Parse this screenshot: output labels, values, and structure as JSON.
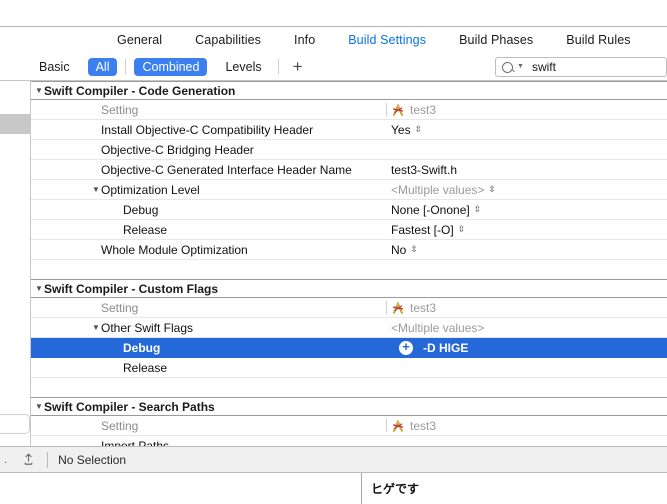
{
  "editor": {
    "tabs": [
      {
        "label": "General",
        "active": false
      },
      {
        "label": "Capabilities",
        "active": false
      },
      {
        "label": "Info",
        "active": false
      },
      {
        "label": "Build Settings",
        "active": true
      },
      {
        "label": "Build Phases",
        "active": false
      },
      {
        "label": "Build Rules",
        "active": false
      }
    ]
  },
  "filterbar": {
    "basic": "Basic",
    "all": "All",
    "combined": "Combined",
    "levels": "Levels",
    "add": "+",
    "search_value": "swift",
    "search_icon": "search-icon"
  },
  "table": {
    "target_name": "test3",
    "setting_column_header": "Setting",
    "groups": [
      {
        "title": "Swift Compiler - Code Generation",
        "rows": [
          {
            "label": "Setting",
            "value": "test3",
            "type": "header"
          },
          {
            "label": "Install Objective-C Compatibility Header",
            "value": "Yes",
            "stepper": true
          },
          {
            "label": "Objective-C Bridging Header",
            "value": ""
          },
          {
            "label": "Objective-C Generated Interface Header Name",
            "value": "test3-Swift.h"
          },
          {
            "label": "Optimization Level",
            "value": "<Multiple values>",
            "stepper": true,
            "expanded": true,
            "muted_value": true
          },
          {
            "label": "Debug",
            "value": "None [-Onone]",
            "stepper": true,
            "indent": 2
          },
          {
            "label": "Release",
            "value": "Fastest [-O]",
            "stepper": true,
            "indent": 2
          },
          {
            "label": "Whole Module Optimization",
            "value": "No",
            "stepper": true
          }
        ]
      },
      {
        "title": "Swift Compiler - Custom Flags",
        "rows": [
          {
            "label": "Setting",
            "value": "test3",
            "type": "header"
          },
          {
            "label": "Other Swift Flags",
            "value": "<Multiple values>",
            "expanded": true,
            "muted_value": true
          },
          {
            "label": "Debug",
            "value": "-D HIGE",
            "indent": 2,
            "selected": true,
            "add_button": true
          },
          {
            "label": "Release",
            "value": "",
            "indent": 2
          }
        ]
      },
      {
        "title": "Swift Compiler - Search Paths",
        "rows": [
          {
            "label": "Setting",
            "value": "test3",
            "type": "header"
          },
          {
            "label": "Import Paths",
            "value": ""
          }
        ]
      }
    ]
  },
  "statusbar": {
    "selection_text": "No Selection",
    "share_icon": "share-upload-icon"
  },
  "bottompane": {
    "text": "ヒゲです"
  },
  "colors": {
    "accent": "#3b7ff0",
    "selection": "#2568d8",
    "link": "#0a72e8",
    "muted": "#9a9a9a"
  }
}
